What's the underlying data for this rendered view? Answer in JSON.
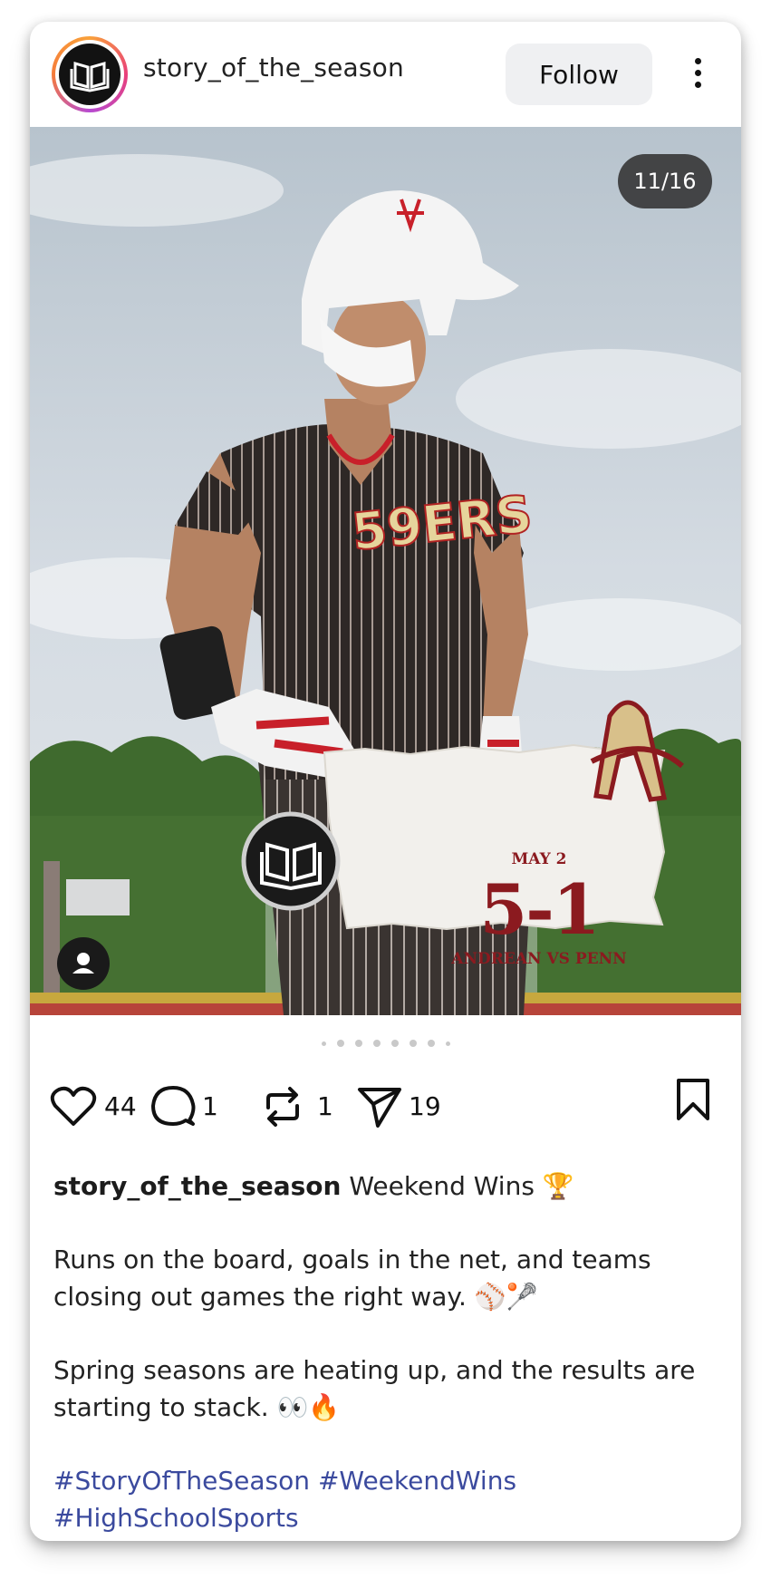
{
  "header": {
    "username": "story_of_the_season",
    "follow_label": "Follow",
    "avatar_icon": "open-book-logo-icon",
    "more_icon": "more-vertical-icon"
  },
  "post": {
    "counter": "11/16",
    "image": {
      "date": "MAY 2",
      "score": "5-1",
      "matchup": "ANDREAN VS PENN",
      "jersey_text": "59ERS"
    },
    "carousel_dots": 8
  },
  "actions": {
    "likes": "44",
    "comments": "1",
    "reposts": "1",
    "shares": "19"
  },
  "caption": {
    "username": "story_of_the_season",
    "title": "Weekend Wins 🏆",
    "line1": "Runs on the board, goals in the net, and teams",
    "line2": "closing out games the right way. ⚾🥍",
    "line3": "Spring seasons are heating up, and the results are",
    "line4": "starting to stack. 👀🔥",
    "hashtags": [
      "#StoryOfTheSeason",
      "#WeekendWins",
      "#HighSchoolSports"
    ]
  },
  "colors": {
    "accent_red": "#8b1a1f",
    "hashtag": "#3b4a9e",
    "follow_bg": "#eff0f2"
  }
}
